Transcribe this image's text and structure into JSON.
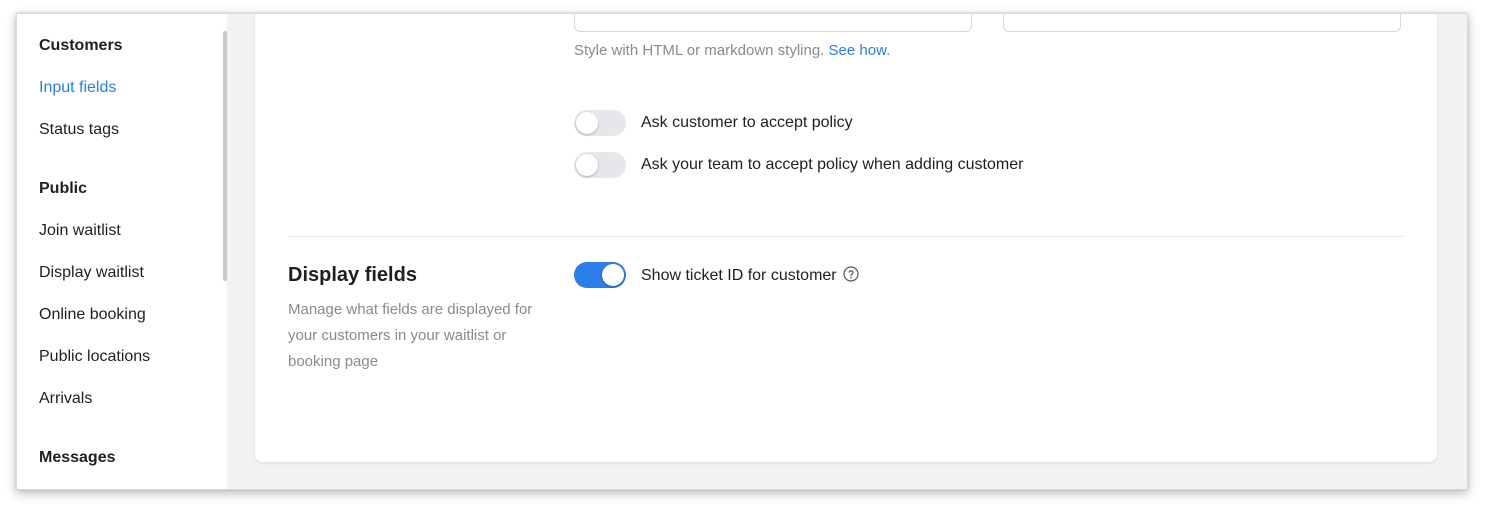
{
  "sidebar": {
    "sections": [
      {
        "title": "Customers",
        "items": [
          {
            "label": "Input fields",
            "active": true
          },
          {
            "label": "Status tags",
            "active": false
          }
        ]
      },
      {
        "title": "Public",
        "items": [
          {
            "label": "Join waitlist",
            "active": false
          },
          {
            "label": "Display waitlist",
            "active": false
          },
          {
            "label": "Online booking",
            "active": false
          },
          {
            "label": "Public locations",
            "active": false
          },
          {
            "label": "Arrivals",
            "active": false
          }
        ]
      },
      {
        "title": "Messages",
        "items": []
      }
    ]
  },
  "policy": {
    "hint_text": "Style with HTML or markdown styling.",
    "hint_link": "See how.",
    "toggles": [
      {
        "label": "Ask customer to accept policy",
        "on": false
      },
      {
        "label": "Ask your team to accept policy when adding customer",
        "on": false
      }
    ]
  },
  "display_fields": {
    "title": "Display fields",
    "description": "Manage what fields are displayed for your customers in your waitlist or booking page",
    "toggles": [
      {
        "label": "Show ticket ID for customer",
        "on": true,
        "icon": "help-circle-icon"
      }
    ]
  },
  "colors": {
    "accent": "#2b7de9",
    "toggle_off": "#e6e7ea",
    "muted_text": "#8a8a8f"
  }
}
